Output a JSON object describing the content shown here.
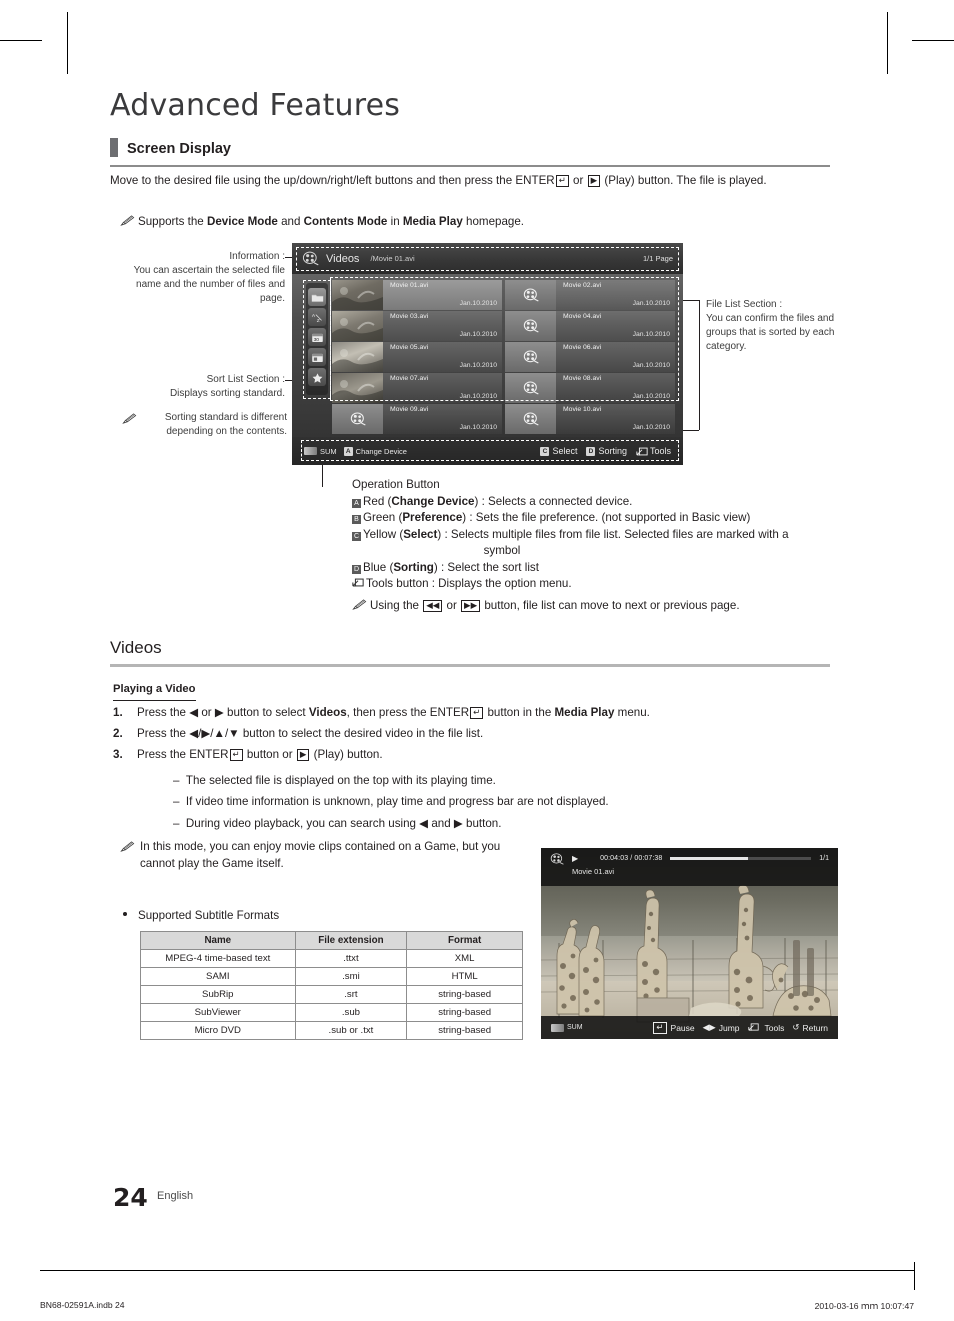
{
  "document": {
    "chapter_title": "Advanced Features",
    "section_title": "Screen Display",
    "intro_line1_a": "Move to the desired file using the up/down/right/left buttons and then press the ENTER",
    "intro_enter_glyph": "↵",
    "intro_line1_b": "or",
    "intro_play_glyph": "▶",
    "intro_line1_c": "(Play) button. The file is played.",
    "note_supports_a": "Supports the ",
    "note_supports_b": "Device Mode",
    "note_supports_c": " and ",
    "note_supports_d": "Contents Mode",
    "note_supports_e": " in ",
    "note_supports_f": "Media Play",
    "note_supports_g": " homepage."
  },
  "annotations": {
    "information": {
      "heading": "Information :",
      "body": "You can ascertain the selected file name and the number of files and page."
    },
    "sort_list": {
      "heading": "Sort List Section :",
      "body": "Displays sorting standard.",
      "note": "Sorting standard is different depending on the contents."
    },
    "file_list": {
      "heading": "File List Section :",
      "body": "You can confirm the files and groups that is sorted by each category."
    }
  },
  "operation_button": {
    "title": "Operation Button",
    "rows": [
      {
        "key": "A",
        "color": "Red",
        "name": "Change Device",
        "desc": ") : Selects a connected device."
      },
      {
        "key": "B",
        "color": "Green",
        "name": "Preference",
        "desc": ")  : Sets the file preference. (not supported in Basic view)"
      },
      {
        "key": "C",
        "color": "Yellow",
        "name": "Select",
        "desc": ") : Selects multiple files from file list. Selected files are marked with a"
      },
      {
        "key": "D",
        "color": "Blue",
        "name": "Sorting",
        "desc": ")  : Select the sort list"
      }
    ],
    "select_wrap": "symbol",
    "tools_label": "Tools button : Displays the option menu.",
    "note_a": "Using the ",
    "note_rew": "◀◀",
    "note_b": " or ",
    "note_ff": "▶▶",
    "note_c": " button, file list can move to next or previous page."
  },
  "tv_mock": {
    "header": {
      "icon": "film-reel-icon",
      "title": "Videos",
      "path": "/Movie 01.avi",
      "page": "1/1 Page"
    },
    "sort_icons": [
      "folder-icon",
      "alphabetical-sort-icon",
      "date-30-icon",
      "calendar-icon",
      "star-favorite-icon"
    ],
    "files": [
      {
        "name": "Movie 01.avi",
        "date": "Jan.10.2010",
        "thumb": "photo",
        "selected": true
      },
      {
        "name": "Movie 02.avi",
        "date": "Jan.10.2010",
        "thumb": "placeholder",
        "selected": false
      },
      {
        "name": "Movie 03.avi",
        "date": "Jan.10.2010",
        "thumb": "photo",
        "selected": false
      },
      {
        "name": "Movie 04.avi",
        "date": "Jan.10.2010",
        "thumb": "placeholder",
        "selected": false
      },
      {
        "name": "Movie 05.avi",
        "date": "Jan.10.2010",
        "thumb": "photo",
        "selected": false
      },
      {
        "name": "Movie 06.avi",
        "date": "Jan.10.2010",
        "thumb": "placeholder",
        "selected": false
      },
      {
        "name": "Movie 07.avi",
        "date": "Jan.10.2010",
        "thumb": "photo",
        "selected": false
      },
      {
        "name": "Movie 08.avi",
        "date": "Jan.10.2010",
        "thumb": "placeholder",
        "selected": false
      },
      {
        "name": "Movie 09.avi",
        "date": "Jan.10.2010",
        "thumb": "placeholder",
        "selected": false
      },
      {
        "name": "Movie 10.avi",
        "date": "Jan.10.2010",
        "thumb": "placeholder",
        "selected": false
      }
    ],
    "footer": {
      "sum": "SUM",
      "a_key": "A",
      "a_label": "Change Device",
      "c_key": "C",
      "c_label": "Select",
      "d_key": "D",
      "d_label": "Sorting",
      "tools_label": "Tools"
    }
  },
  "videos": {
    "heading": "Videos",
    "sub_heading": "Playing a Video",
    "steps": [
      {
        "num": "1.",
        "a": "Press the ◀ or ▶ button to select ",
        "bold1": "Videos",
        "b": ", then press the ENTER",
        "glyph": "↵",
        "c": " button in the ",
        "bold2": "Media Play",
        "d": " menu."
      },
      {
        "num": "2.",
        "a": "Press the ◀/▶/▲/▼ button to select the desired video in the file list.",
        "bold1": "",
        "b": "",
        "glyph": "",
        "c": "",
        "bold2": "",
        "d": ""
      },
      {
        "num": "3.",
        "a": "Press the ENTER",
        "bold1": "",
        "b": "",
        "glyph": "↵",
        "c": " button or ",
        "bold2": "",
        "d": " (Play) button."
      }
    ],
    "dashes": [
      "The selected file is displayed on the top with its playing time.",
      "If video time information is unknown, play time and progress bar are not displayed.",
      "During video playback, you can search using ◀ and ▶ button."
    ],
    "note": "In this mode, you can enjoy movie clips contained on a Game, but you cannot play the Game itself.",
    "subtitle_bullet": "Supported Subtitle Formats"
  },
  "subtitle_table": {
    "headers": [
      "Name",
      "File extension",
      "Format"
    ],
    "rows": [
      [
        "MPEG-4 time-based text",
        ".ttxt",
        "XML"
      ],
      [
        "SAMI",
        ".smi",
        "HTML"
      ],
      [
        "SubRip",
        ".srt",
        "string-based"
      ],
      [
        "SubViewer",
        ".sub",
        "string-based"
      ],
      [
        "Micro DVD",
        ".sub or .txt",
        "string-based"
      ]
    ]
  },
  "player_mock": {
    "icon": "film-reel-icon",
    "play_glyph": "▶",
    "time": "00:04:03 / 00:07:38",
    "page": "1/1",
    "filename": "Movie 01.avi",
    "sum": "SUM",
    "controls": [
      {
        "glyph": "↵",
        "label": "Pause"
      },
      {
        "glyph": "◀▶",
        "label": "Jump"
      },
      {
        "glyph": "❐",
        "label": "Tools"
      },
      {
        "glyph": "↺",
        "label": "Return"
      }
    ]
  },
  "page_footer": {
    "number": "24",
    "language": "English",
    "file": "BN68-02591A.indb   24",
    "timestamp": "2010-03-16   ｍｍ 10:07:47"
  }
}
